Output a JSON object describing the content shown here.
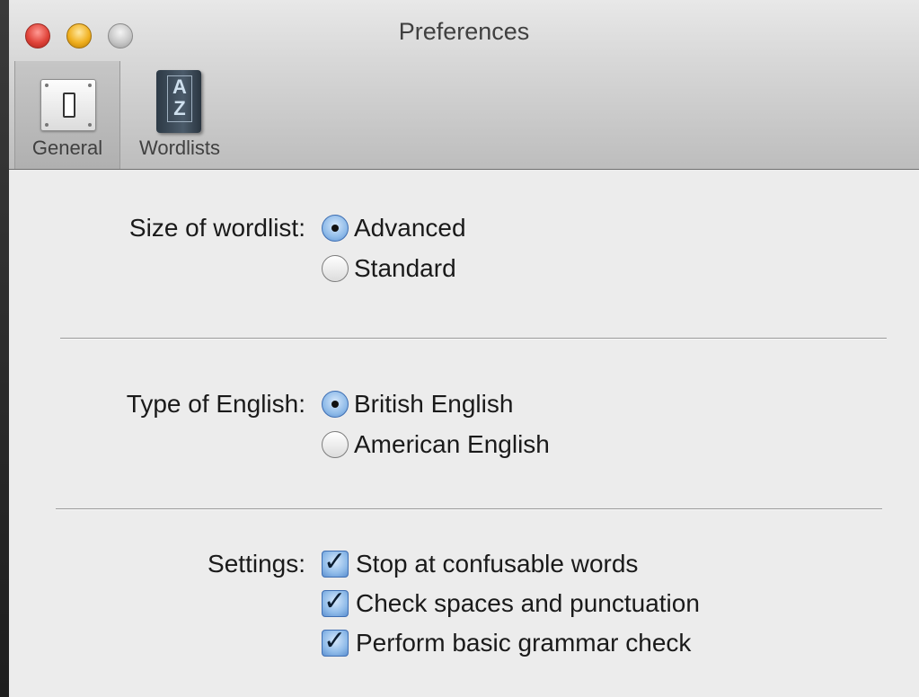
{
  "window": {
    "title": "Preferences"
  },
  "toolbar": {
    "general_label": "General",
    "wordlists_label": "Wordlists",
    "book_letter_top": "A",
    "book_letter_bottom": "Z"
  },
  "size_section": {
    "label": "Size of wordlist:",
    "options": [
      {
        "label": "Advanced",
        "selected": true
      },
      {
        "label": "Standard",
        "selected": false
      }
    ]
  },
  "english_section": {
    "label": "Type of English:",
    "options": [
      {
        "label": "British English",
        "selected": true
      },
      {
        "label": "American English",
        "selected": false
      }
    ]
  },
  "settings_section": {
    "label": "Settings:",
    "checkboxes": [
      {
        "label": "Stop at confusable words",
        "checked": true
      },
      {
        "label": "Check spaces and punctuation",
        "checked": true
      },
      {
        "label": "Perform basic grammar check",
        "checked": true
      }
    ]
  },
  "colors": {
    "accent": "#5c8fcf",
    "window_bg": "#ececec"
  },
  "icons": {
    "close": "close-icon",
    "minimize": "minimize-icon",
    "zoom": "zoom-icon",
    "general": "switch-icon",
    "wordlists": "book-icon",
    "check": "checkmark-icon"
  }
}
